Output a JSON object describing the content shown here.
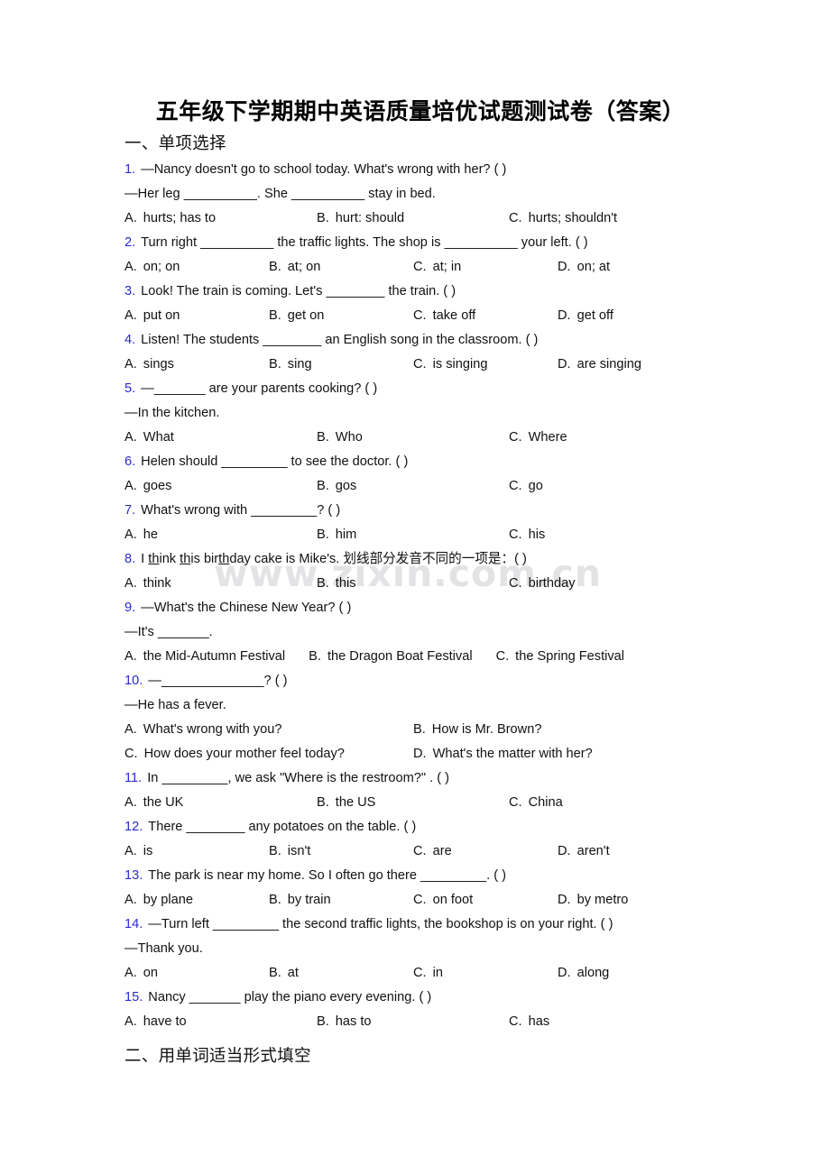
{
  "document": {
    "title": "五年级下学期期中英语质量培优试题测试卷（答案）",
    "watermark": "www.zixin.com.cn"
  },
  "sections": [
    {
      "heading": "一、单项选择"
    },
    {
      "heading": "二、用单词适当形式填空"
    }
  ],
  "questions": [
    {
      "num": "1.",
      "stem": "—Nancy doesn't go to school today. What's wrong with her? (    )",
      "stem2": "—Her leg __________. She __________ stay in bed.",
      "layout": "c3",
      "options": [
        {
          "label": "A.",
          "text": "hurts; has to"
        },
        {
          "label": "B.",
          "text": "hurt: should"
        },
        {
          "label": "C.",
          "text": "hurts; shouldn't"
        }
      ]
    },
    {
      "num": "2.",
      "stem": "Turn right __________ the traffic lights. The shop is __________ your left. (    )",
      "layout": "c4",
      "options": [
        {
          "label": "A.",
          "text": "on; on"
        },
        {
          "label": "B.",
          "text": "at; on"
        },
        {
          "label": "C.",
          "text": "at; in"
        },
        {
          "label": "D.",
          "text": "on; at"
        }
      ]
    },
    {
      "num": "3.",
      "stem": "Look! The train is coming. Let's ________ the train. (  )",
      "layout": "c4",
      "options": [
        {
          "label": "A.",
          "text": "put on"
        },
        {
          "label": "B.",
          "text": "get on"
        },
        {
          "label": "C.",
          "text": "take off"
        },
        {
          "label": "D.",
          "text": "get off"
        }
      ]
    },
    {
      "num": "4.",
      "stem": "Listen! The students ________ an English song in the classroom. (  )",
      "layout": "c4",
      "options": [
        {
          "label": "A.",
          "text": "sings"
        },
        {
          "label": "B.",
          "text": "sing"
        },
        {
          "label": "C.",
          "text": "is singing"
        },
        {
          "label": "D.",
          "text": "are singing"
        }
      ]
    },
    {
      "num": "5.",
      "stem": "—_______ are your parents cooking? (  )",
      "stem2": "—In the kitchen.",
      "layout": "c3",
      "options": [
        {
          "label": "A.",
          "text": "What"
        },
        {
          "label": "B.",
          "text": "Who"
        },
        {
          "label": "C.",
          "text": "Where"
        }
      ]
    },
    {
      "num": "6.",
      "stem": "Helen should _________ to see the doctor. (    )",
      "layout": "c3",
      "options": [
        {
          "label": "A.",
          "text": "goes"
        },
        {
          "label": "B.",
          "text": "gos"
        },
        {
          "label": "C.",
          "text": "go"
        }
      ]
    },
    {
      "num": "7.",
      "stem": "What's wrong with _________? (    )",
      "layout": "c3",
      "options": [
        {
          "label": "A.",
          "text": "he"
        },
        {
          "label": "B.",
          "text": "him"
        },
        {
          "label": "C.",
          "text": "his"
        }
      ]
    },
    {
      "num": "8.",
      "stem_parts": [
        {
          "t": "I "
        },
        {
          "t": "th",
          "u": true
        },
        {
          "t": "ink "
        },
        {
          "t": "th",
          "u": true
        },
        {
          "t": "is bir"
        },
        {
          "t": "th",
          "u": true
        },
        {
          "t": "day cake is Mike's. 划线部分发音不同的一项是：(    )"
        }
      ],
      "layout": "c3",
      "options": [
        {
          "label": "A.",
          "text": "think"
        },
        {
          "label": "B.",
          "text": "this"
        },
        {
          "label": "C.",
          "text": "birthday"
        }
      ]
    },
    {
      "num": "9.",
      "stem": "—What's the Chinese New Year? (    )",
      "stem2": "—It's _______.",
      "layout": "flow",
      "options": [
        {
          "label": "A.",
          "text": "the Mid-Autumn Festival"
        },
        {
          "label": "B.",
          "text": "the Dragon Boat Festival"
        },
        {
          "label": "C.",
          "text": "the Spring Festival"
        }
      ]
    },
    {
      "num": "10.",
      "stem": "—______________? (    )",
      "stem2": "—He has a fever.",
      "layout": "c2",
      "options": [
        {
          "label": "A.",
          "text": "What's wrong with you?"
        },
        {
          "label": "B.",
          "text": "How is Mr. Brown?"
        },
        {
          "label": "C.",
          "text": "How does your mother feel today?"
        },
        {
          "label": "D.",
          "text": "What's the matter with her?"
        }
      ]
    },
    {
      "num": "11.",
      "stem": "In _________, we ask \"Where is the restroom?\" . (   )",
      "layout": "c3",
      "options": [
        {
          "label": "A.",
          "text": "the UK"
        },
        {
          "label": "B.",
          "text": "the US"
        },
        {
          "label": "C.",
          "text": "China"
        }
      ]
    },
    {
      "num": "12.",
      "stem": "There ________ any potatoes on the table. (  )",
      "layout": "c4",
      "options": [
        {
          "label": "A.",
          "text": "is"
        },
        {
          "label": "B.",
          "text": "isn't"
        },
        {
          "label": "C.",
          "text": "are"
        },
        {
          "label": "D.",
          "text": "aren't"
        }
      ]
    },
    {
      "num": "13.",
      "stem": "The park is near my home. So I often go there _________. (  )",
      "layout": "c4",
      "options": [
        {
          "label": "A.",
          "text": "by plane"
        },
        {
          "label": "B.",
          "text": "by train"
        },
        {
          "label": "C.",
          "text": "on foot"
        },
        {
          "label": "D.",
          "text": "by metro"
        }
      ]
    },
    {
      "num": "14.",
      "stem": "—Turn left _________ the second traffic lights, the bookshop is on your right. (  )",
      "stem2": "—Thank you.",
      "layout": "c4",
      "options": [
        {
          "label": "A.",
          "text": "on"
        },
        {
          "label": "B.",
          "text": "at"
        },
        {
          "label": "C.",
          "text": "in"
        },
        {
          "label": "D.",
          "text": "along"
        }
      ]
    },
    {
      "num": "15.",
      "stem": "Nancy _______ play the piano every evening. (  )",
      "layout": "c3",
      "options": [
        {
          "label": "A.",
          "text": "have to"
        },
        {
          "label": "B.",
          "text": "has to"
        },
        {
          "label": "C.",
          "text": "has"
        }
      ]
    }
  ]
}
